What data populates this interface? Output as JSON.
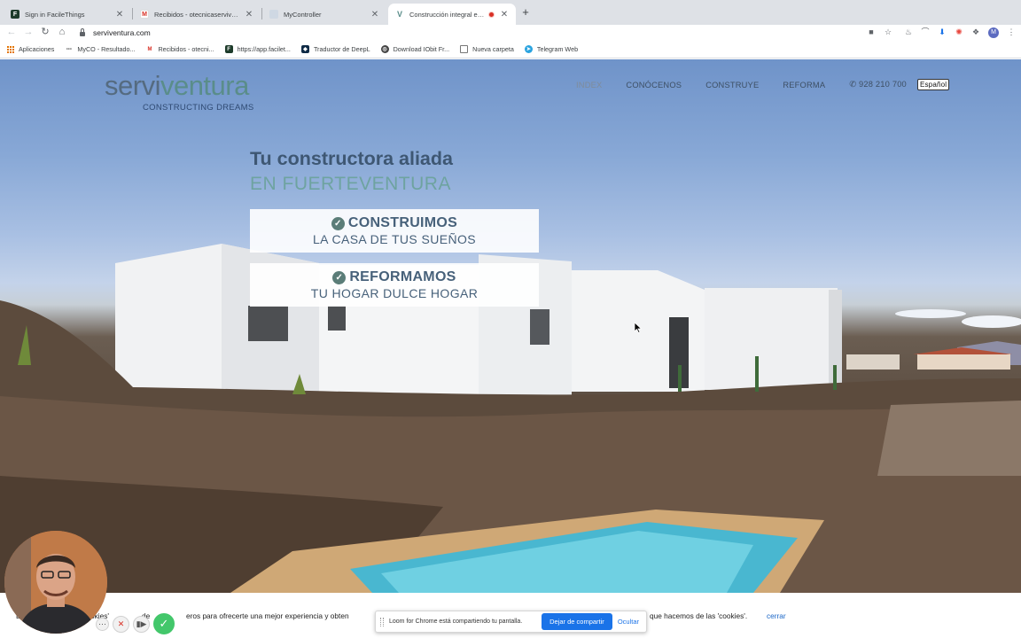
{
  "browser": {
    "tabs": [
      {
        "title": "Sign in FacileThings",
        "icon": "facile-icon",
        "active": false
      },
      {
        "title": "Recibidos - otecnicaserviventu",
        "icon": "gmail-icon",
        "active": false
      },
      {
        "title": "MyController",
        "icon": "page-icon",
        "active": false
      },
      {
        "title": "Construcción integral en F",
        "icon": "serviventura-icon",
        "active": true
      }
    ],
    "url": "serviventura.com",
    "bookmarks": [
      {
        "label": "Aplicaciones",
        "icon": "apps-grid-icon"
      },
      {
        "label": "MyCO - Resultado...",
        "icon": "myco-icon"
      },
      {
        "label": "Recibidos - otecni...",
        "icon": "gmail-icon"
      },
      {
        "label": "https://app.facilet...",
        "icon": "facile-icon"
      },
      {
        "label": "Traductor de DeepL",
        "icon": "deepl-icon"
      },
      {
        "label": "Download IObit Fr...",
        "icon": "iobit-icon"
      },
      {
        "label": "Nueva carpeta",
        "icon": "folder-icon"
      },
      {
        "label": "Telegram Web",
        "icon": "telegram-icon"
      }
    ],
    "profile_initial": "M"
  },
  "site": {
    "logo_main_1": "servi",
    "logo_main_2": "ventura",
    "logo_tagline": "CONSTRUCTING DREAMS",
    "nav": [
      "INDEX",
      "CONÓCENOS",
      "CONSTRUYE",
      "REFORMA"
    ],
    "phone": "928 210 700",
    "language": "Español",
    "hero_title": "Tu constructora aliada",
    "hero_subtitle": "EN FUERTEVENTURA",
    "cta": [
      {
        "title": "CONSTRUIMOS",
        "subtitle": "LA CASA DE TUS SUEÑOS"
      },
      {
        "title": "REFORMAMOS",
        "subtitle": "TU HOGAR DULCE HOGAR"
      }
    ]
  },
  "cookie_bar": {
    "text_left": "E",
    "text_fragment_1": "okies'",
    "text_fragment_2": "de",
    "text_fragment_3": "eros para ofrecerte una mejor experiencia y obten",
    "text_right": "que hacemos de las 'cookies'.",
    "close_label": "cerrar"
  },
  "screen_share": {
    "message": "Loom for Chrome está compartiendo tu pantalla.",
    "stop_label": "Dejar de compartir",
    "hide_label": "Ocultar"
  },
  "colors": {
    "brand_teal": "#5a8d8a",
    "brand_navy": "#3e5773",
    "chrome_blue": "#1a73e8"
  }
}
